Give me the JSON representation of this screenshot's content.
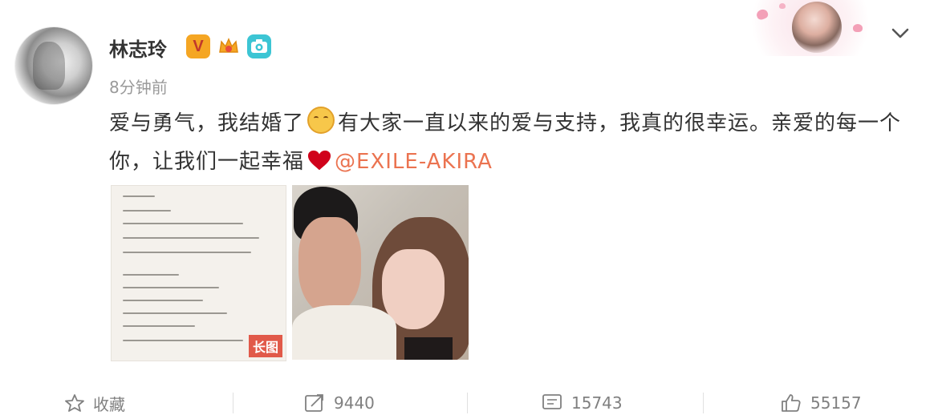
{
  "user": {
    "name": "林志玲"
  },
  "post": {
    "time": "8分钟前",
    "text_part1": "爱与勇气，我结婚了",
    "text_part2": "有大家一直以来的爱与支持，我真的很幸运。亲爱的每一个你，让我们一起幸福",
    "mention": "@EXILE-AKIRA",
    "images": [
      {
        "badge": "长图"
      }
    ]
  },
  "actions": {
    "favorite_label": "收藏",
    "repost_count": "9440",
    "comment_count": "15743",
    "like_count": "55157"
  },
  "colors": {
    "mention": "#eb7350",
    "text": "#333333",
    "meta": "#9a9a9a"
  }
}
